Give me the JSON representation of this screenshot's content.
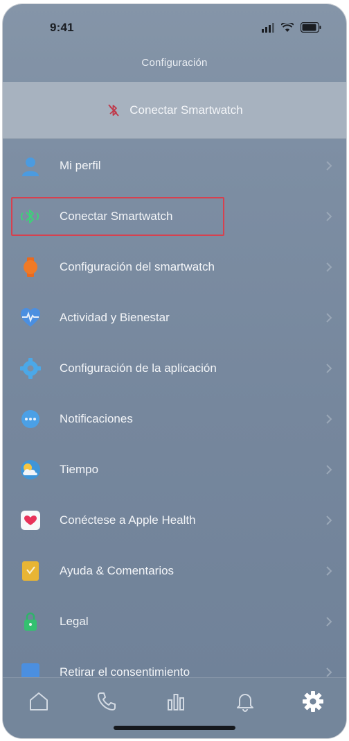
{
  "status_bar": {
    "time": "9:41",
    "icons": [
      "signal-icon",
      "wifi-icon",
      "battery-icon"
    ]
  },
  "header": {
    "title": "Configuración"
  },
  "banner": {
    "label": "Conectar Smartwatch",
    "icon": "bluetooth-off-icon",
    "icon_color": "#c0394a"
  },
  "menu": {
    "items": [
      {
        "label": "Mi perfil",
        "icon": "person-icon"
      },
      {
        "label": "Conectar Smartwatch",
        "icon": "bluetooth-icon"
      },
      {
        "label": "Configuración del smartwatch",
        "icon": "watch-icon"
      },
      {
        "label": "Actividad y Bienestar",
        "icon": "heart-activity-icon"
      },
      {
        "label": "Configuración de la aplicación",
        "icon": "gear-icon"
      },
      {
        "label": "Notificaciones",
        "icon": "chat-bubble-icon"
      },
      {
        "label": "Tiempo",
        "icon": "weather-icon"
      },
      {
        "label": "Conéctese a Apple Health",
        "icon": "health-icon"
      },
      {
        "label": "Ayuda & Comentarios",
        "icon": "help-icon"
      },
      {
        "label": "Legal",
        "icon": "lock-icon"
      },
      {
        "label": "Retirar el consentimiento",
        "icon": "document-icon"
      }
    ],
    "highlight_color": "#d6414f"
  },
  "tab_bar": {
    "tabs": [
      {
        "icon": "home-icon"
      },
      {
        "icon": "phone-icon"
      },
      {
        "icon": "stats-icon"
      },
      {
        "icon": "bell-icon"
      },
      {
        "icon": "settings-icon",
        "active": true
      }
    ]
  },
  "colors": {
    "background": "#7d8ea3",
    "banner": "#a7b2bf",
    "text": "#f3f5f8",
    "bluetooth_green": "#3ed07a"
  }
}
